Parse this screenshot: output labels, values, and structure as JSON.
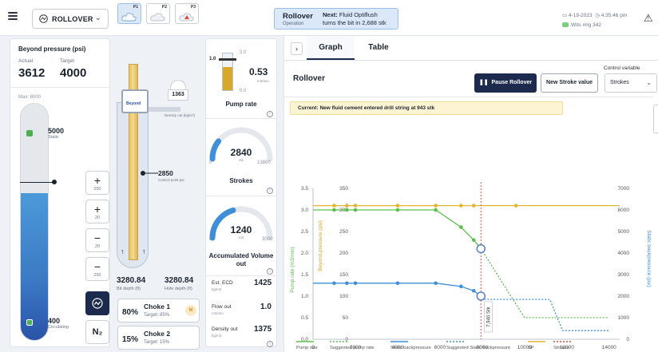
{
  "topbar": {
    "mode": "ROLLOVER",
    "operation_title": "Rollover",
    "operation_sub": "Operation",
    "next_label": "Next:",
    "next_text_1": "Fluid Optiflush",
    "next_text_2": "turns the bit in 2,688 stk",
    "date": "4-19-2023",
    "time": "4:35:46 pm",
    "status_a": "Wits",
    "status_b": "#rig 342"
  },
  "beyond_pressure": {
    "title": "Beyond pressure (psi)",
    "actual_label": "Actual",
    "actual": "3612",
    "target_label": "Target",
    "target": "4000",
    "max_label": "Max: 8000",
    "static_value": "5000",
    "static_label": "Static",
    "circ_value": "400",
    "circ_label": "Circulating",
    "fill_fraction": 0.62,
    "steps": [
      {
        "sym": "+",
        "amt": "250"
      },
      {
        "sym": "+",
        "amt": "20"
      },
      {
        "sym": "−",
        "amt": "20"
      },
      {
        "sym": "−",
        "amt": "250"
      }
    ],
    "n2": "N₂"
  },
  "well": {
    "p_labels": [
      "P1",
      "P2",
      "P3"
    ],
    "bop_name": "Beyond",
    "density_out": "1363",
    "density_label": "Density out (kg/m³)",
    "control_point": "2850",
    "control_label": "Control point psi",
    "bit_depth": "3280.84",
    "bit_depth_label": "Bit depth (ft)",
    "hole_depth": "3280.84",
    "hole_depth_label": "Hole depth (ft)",
    "chokes": [
      {
        "pct": "80%",
        "name": "Choke 1",
        "target": "Target: 85%",
        "badge": "M"
      },
      {
        "pct": "15%",
        "name": "Choke 2",
        "target": "Target: 15%",
        "badge": ""
      }
    ]
  },
  "pump": {
    "max": "3.0",
    "setpoint": "1.0",
    "zero": "0.0",
    "value": "0.53",
    "unit": "m3/min",
    "title": "Pump rate",
    "fill_fraction": 0.62,
    "strokes_value": "2840",
    "strokes_unit": "stk",
    "strokes_min": "0",
    "strokes_max": "13800",
    "strokes_title": "Strokes",
    "strokes_fraction": 0.21,
    "acc_value": "1240",
    "acc_unit": "m3",
    "acc_min": "0",
    "acc_max": "3000",
    "acc_title": "Accumulated Volume out",
    "acc_fraction": 0.41,
    "ecd_label": "Est. ECD",
    "ecd_unit": "kg/m3",
    "ecd": "1425",
    "flow_label": "Flow out",
    "flow_unit": "m3/min",
    "flow": "1.0",
    "dens_label": "Density out",
    "dens_unit": "kg/m3",
    "dens": "1375"
  },
  "right": {
    "tabs": [
      "Graph",
      "Table"
    ],
    "control_label": "Control variable",
    "control_value": "Strokes",
    "section_title": "Rollover",
    "pause_label": "Pause Rollover",
    "new_sv_label": "New Stroke value",
    "current_msg": "Current: New fluid cement entered drill string at 943 stk"
  },
  "chart_data": {
    "type": "line",
    "xlabel": "Strokes",
    "x_ticks": [
      0,
      2000,
      4000,
      6000,
      8000,
      10000,
      12000,
      14000
    ],
    "xlim": [
      0,
      14500
    ],
    "y_pump_label": "Pump rate (m3/min)",
    "y_pump_ticks": [
      "0.0",
      "0.5",
      "1.0",
      "1.5",
      "2.0",
      "2.5",
      "3.0",
      "3.5"
    ],
    "y_pump_lim": [
      0,
      3.5
    ],
    "y_bp_label": "Beyond pressure (psi)",
    "y_bp_ticks": [
      "0",
      "50",
      "100",
      "150",
      "200",
      "250",
      "300",
      "350"
    ],
    "y_bp_lim": [
      0,
      350
    ],
    "y_static_label": "Static backpressure (psi)",
    "y_static_ticks": [
      "0",
      "1000",
      "2000",
      "3000",
      "4000",
      "5000",
      "6000",
      "7000"
    ],
    "y_static_lim": [
      0,
      7000
    ],
    "marker_label": "7,940 Stk",
    "strokes_marker": 7940,
    "series": [
      {
        "name": "Pump rate",
        "axis": "pump",
        "color": "#5bbf4a",
        "dash": false,
        "x": [
          0,
          1000,
          2000,
          4000,
          5800,
          7000,
          7600,
          7940
        ],
        "y": [
          3.0,
          3.0,
          3.0,
          3.0,
          3.0,
          2.6,
          2.3,
          2.1
        ]
      },
      {
        "name": "Suggested pump rate",
        "axis": "pump",
        "color": "#5bbf4a",
        "dash": true,
        "x": [
          7940,
          10000,
          14000
        ],
        "y": [
          2.1,
          0.5,
          0.5
        ]
      },
      {
        "name": "Static backpressure",
        "axis": "static",
        "color": "#3f8ed8",
        "dash": false,
        "x": [
          0,
          1000,
          1600,
          2000,
          3000,
          5800,
          7000,
          7600,
          7940
        ],
        "y": [
          2600,
          2600,
          2600,
          2600,
          2600,
          2600,
          2450,
          2250,
          2000
        ]
      },
      {
        "name": "Suggested Static backpressure",
        "axis": "static",
        "color": "#3f8ed8",
        "dash": true,
        "x": [
          7940,
          11200,
          11800,
          12000,
          14000
        ],
        "y": [
          1850,
          1850,
          400,
          400,
          400
        ]
      },
      {
        "name": "SP",
        "axis": "bp",
        "color": "#e0b530",
        "dash": false,
        "x": [
          0,
          14500
        ],
        "y": [
          310,
          310
        ]
      },
      {
        "name": "Strokes",
        "axis": "none",
        "color": "#e04a3a",
        "dash": true,
        "x": [],
        "y": []
      }
    ],
    "points": {
      "pump": [
        [
          1000,
          3.0
        ],
        [
          1600,
          3.0
        ],
        [
          2000,
          3.0
        ],
        [
          4000,
          3.0
        ],
        [
          5800,
          3.0
        ],
        [
          7000,
          2.6
        ],
        [
          7600,
          2.3
        ]
      ],
      "bp": [
        [
          1000,
          310
        ],
        [
          1600,
          310
        ],
        [
          2000,
          310
        ],
        [
          4000,
          310
        ],
        [
          5800,
          310
        ],
        [
          7000,
          310
        ],
        [
          7600,
          310
        ],
        [
          9600,
          310
        ]
      ],
      "static": [
        [
          1000,
          2600
        ],
        [
          1600,
          2600
        ],
        [
          2000,
          2600
        ],
        [
          4000,
          2600
        ],
        [
          5800,
          2600
        ],
        [
          7000,
          2450
        ],
        [
          7600,
          2250
        ]
      ]
    },
    "legend": [
      "Pump rate",
      "Suggested pump rate",
      "Static backpressure",
      "Suggested Static backpressure",
      "SP",
      "Strokes"
    ],
    "legend_placement": "bottom"
  }
}
